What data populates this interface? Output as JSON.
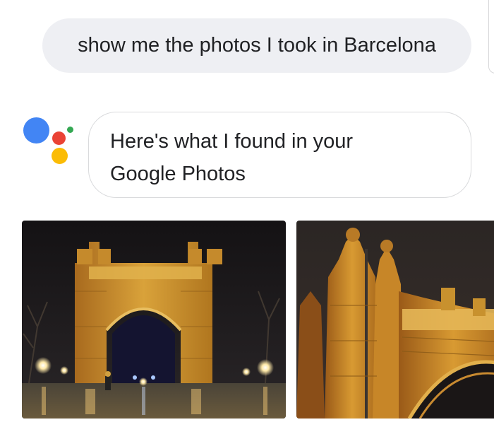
{
  "conversation": {
    "user_query": "show me the photos I took in Barcelona",
    "assistant_response_line1": "Here's what I found in your",
    "assistant_response_line2": "Google Photos"
  },
  "assistant_logo": {
    "name": "google-assistant-logo",
    "colors": {
      "blue": "#4285f4",
      "red": "#ea4335",
      "yellow": "#fbbc05",
      "green": "#34a853"
    }
  },
  "photo_results": [
    {
      "subject": "arc-de-triomf-night-wide",
      "icon": "photo-thumbnail"
    },
    {
      "subject": "arc-de-triomf-night-closeup",
      "icon": "photo-thumbnail"
    }
  ],
  "colors": {
    "user_bubble_bg": "#eeeff3",
    "text": "#202124",
    "bubble_border": "#d9dadc",
    "brick_lit": "#d39a2a",
    "night_sky": "#1c1a1c"
  }
}
